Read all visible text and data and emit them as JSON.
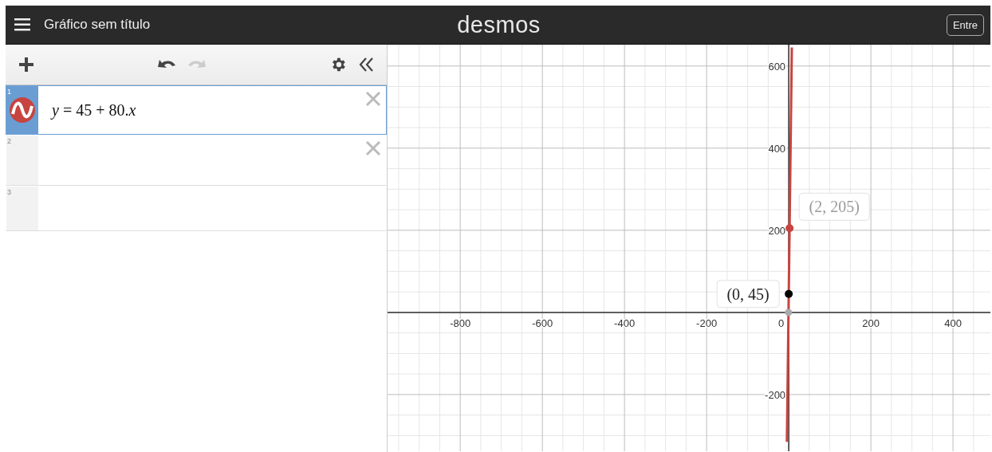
{
  "header": {
    "title": "Gráfico sem título",
    "logo": "desmos",
    "signin": "Entre"
  },
  "toolbar": {
    "undo_disabled": false,
    "redo_disabled": true
  },
  "expressions": [
    {
      "number": "1",
      "latex": "*y* = 45 + 80.*x*",
      "selected": true,
      "color": "#c74440",
      "deletable": true
    },
    {
      "number": "2",
      "selected": false,
      "deletable": true
    },
    {
      "number": "3",
      "selected": false,
      "deletable": false
    }
  ],
  "graph": {
    "chart_data": {
      "type": "line",
      "x": [
        -4.5,
        7.5
      ],
      "series": [
        {
          "color": "#c74440",
          "values": [
            -315,
            645
          ]
        }
      ],
      "xlim": [
        -977,
        493
      ],
      "ylim": [
        -338,
        652
      ],
      "grid": true,
      "xticks": [
        -800,
        -600,
        -400,
        -200,
        200,
        400
      ],
      "yticks": [
        -200,
        200,
        400,
        600
      ],
      "annotations": [
        {
          "x": 0,
          "y": 45,
          "text": "(0, 45)"
        },
        {
          "x": 2,
          "y": 205,
          "text": "(2, 205)"
        }
      ]
    },
    "origin_label": "0",
    "intercept": {
      "color": "#aaaaaa"
    },
    "points": [
      {
        "color": "#000000",
        "label_left": true,
        "faded": false
      },
      {
        "color": "#c74440",
        "label_left": false,
        "faded": true
      }
    ]
  }
}
